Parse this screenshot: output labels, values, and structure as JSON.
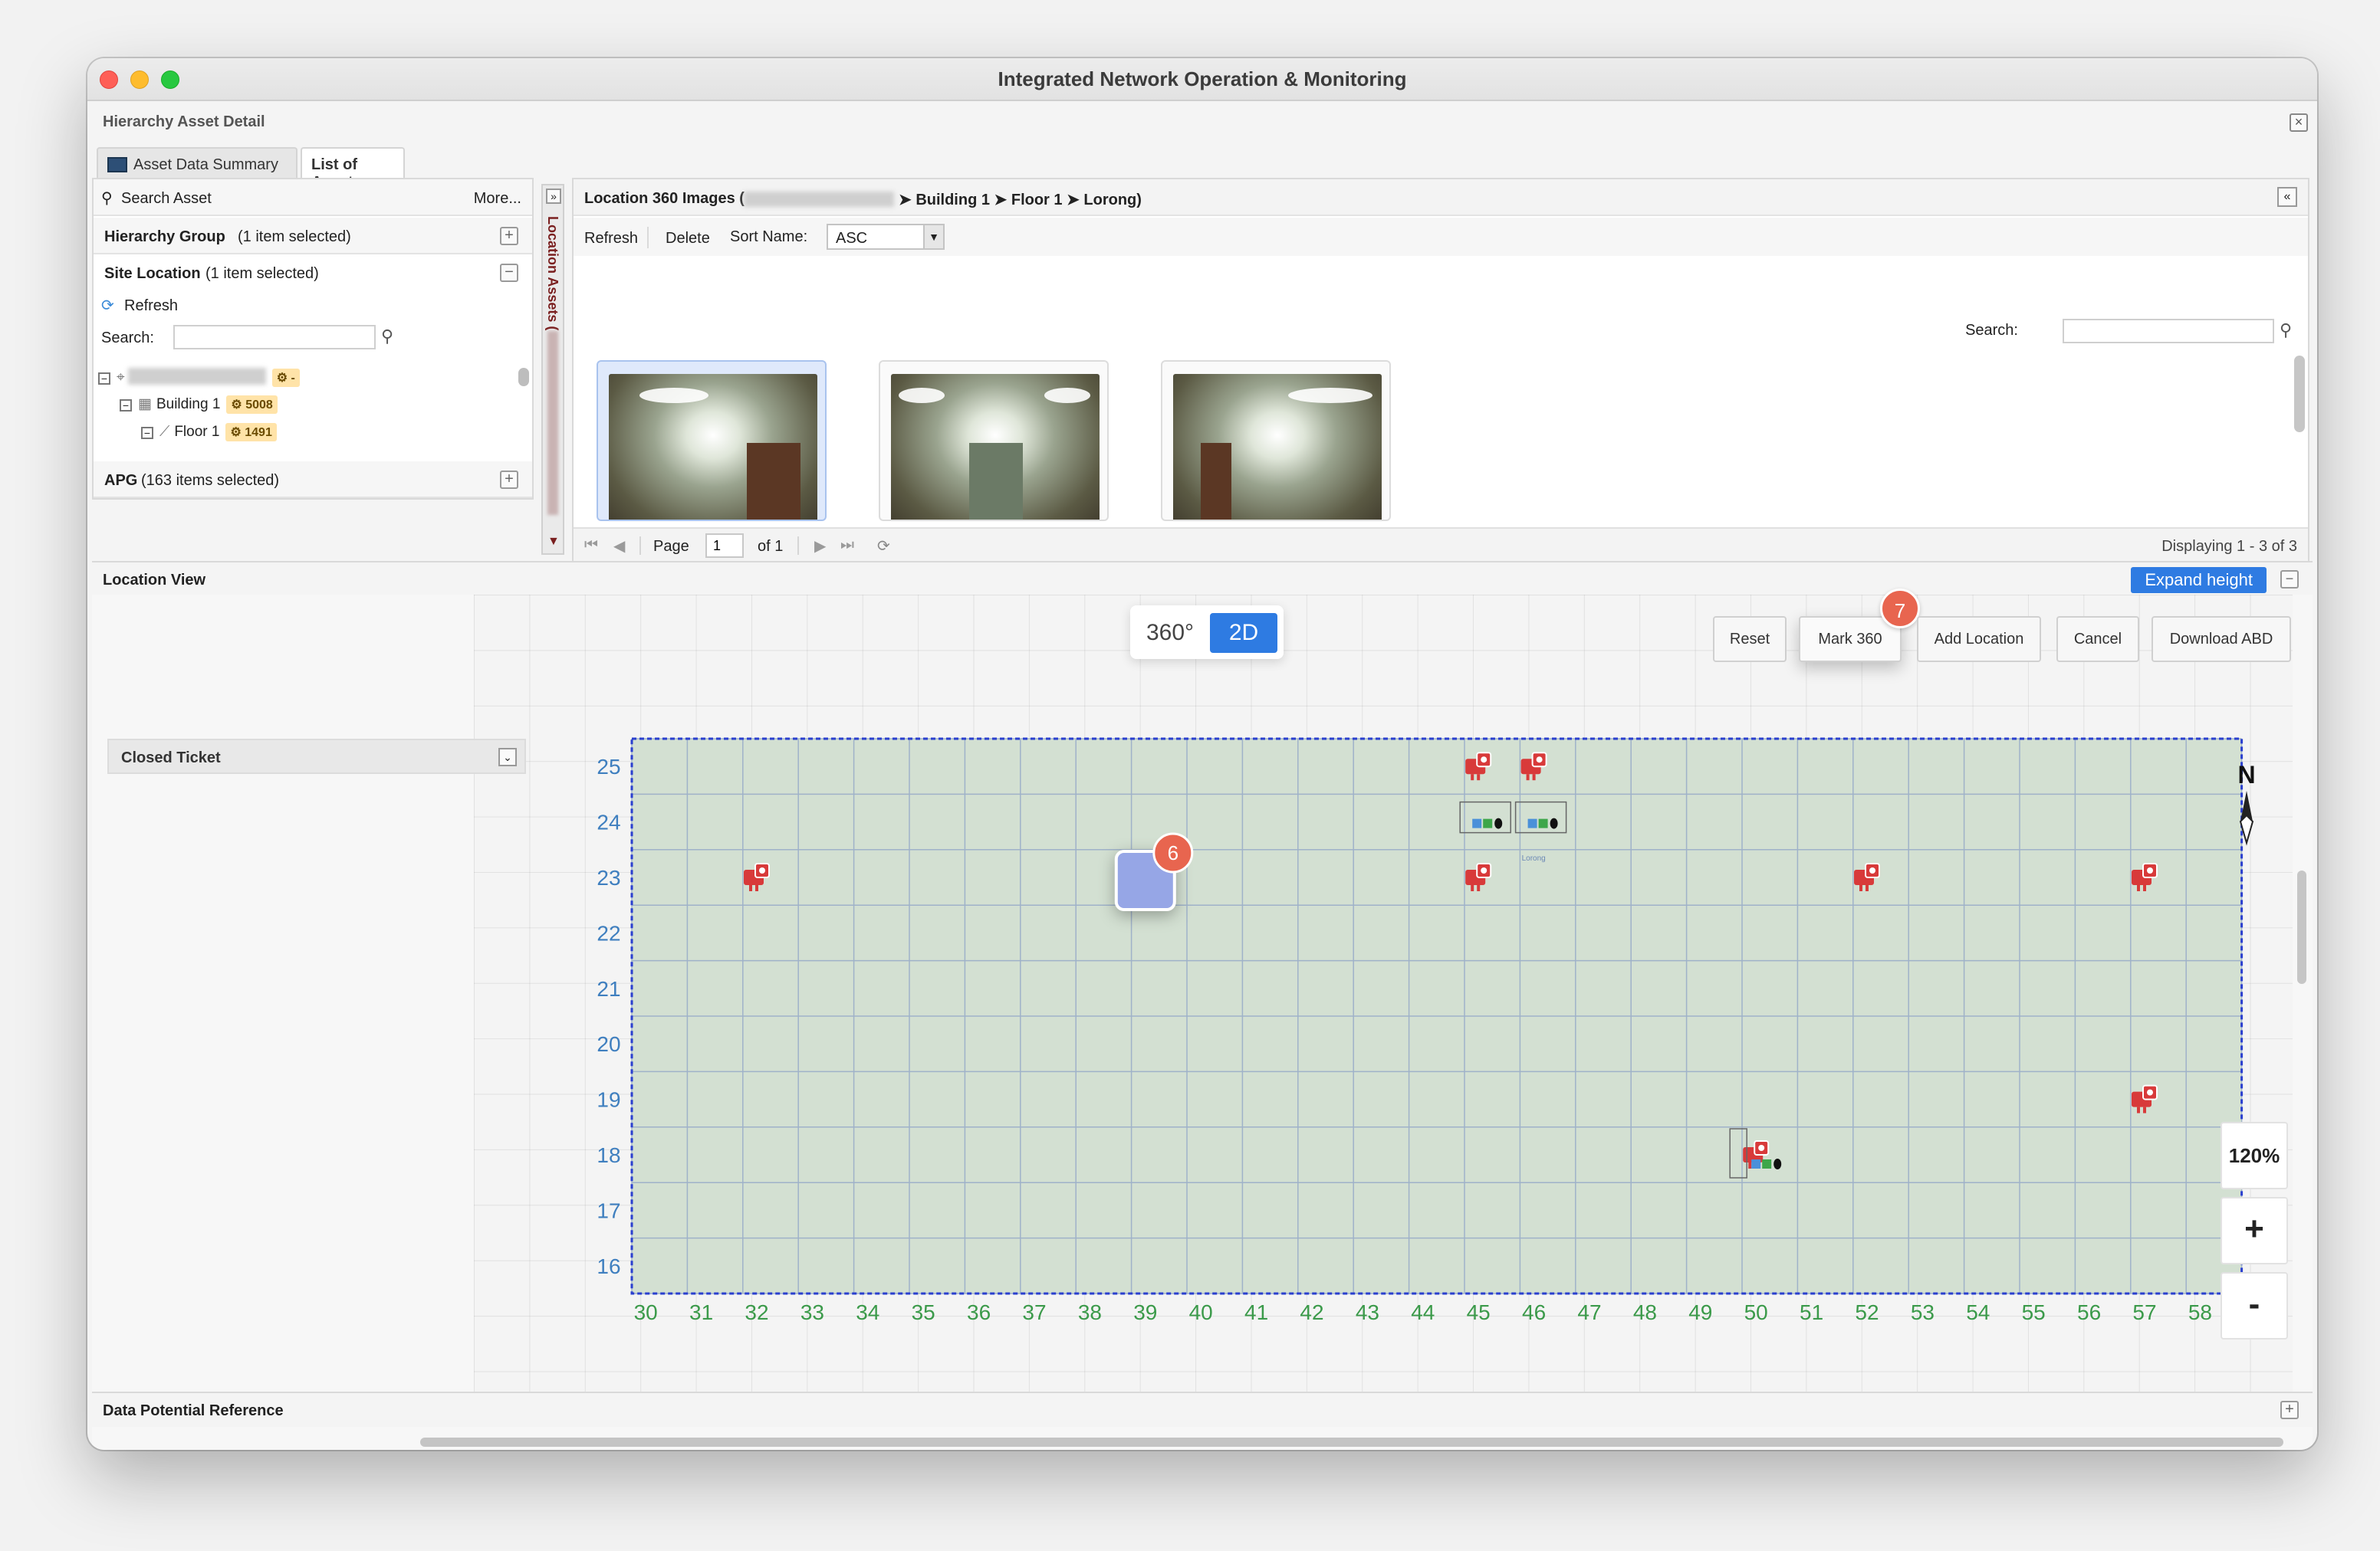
{
  "window": {
    "title": "Integrated Network Operation & Monitoring"
  },
  "panel": {
    "title": "Hierarchy Asset Detail",
    "close_icon": "close-icon"
  },
  "tabs": [
    {
      "label": "Asset Data Summary",
      "icon": "monitor-icon",
      "active": false
    },
    {
      "label": "List of Asset",
      "active": true
    }
  ],
  "left": {
    "search_asset_label": "Search Asset",
    "more_label": "More...",
    "hierarchy_group": {
      "label": "Hierarchy Group",
      "count": "(1 item selected)"
    },
    "site_location": {
      "label": "Site Location",
      "count": "(1 item selected)"
    },
    "refresh_label": "Refresh",
    "search_label": "Search:",
    "search_value": "",
    "tree": [
      {
        "label": "",
        "badge": "-",
        "level": 0
      },
      {
        "label": "Building 1",
        "badge": "5008",
        "level": 1
      },
      {
        "label": "Floor 1",
        "badge": "1491",
        "level": 2
      }
    ],
    "apg": {
      "label": "APG",
      "count": "(163 items selected)"
    }
  },
  "sidebar_vertical": {
    "label": "Location Assets ("
  },
  "right": {
    "header": {
      "prefix": "Location 360 Images (",
      "path": "➤ Building 1 ➤ Floor 1 ➤ Lorong)"
    },
    "toolbar": {
      "refresh": "Refresh",
      "delete": "Delete",
      "sort_label": "Sort Name:",
      "sort_value": "ASC"
    },
    "search_label": "Search:",
    "search_value": "",
    "pager": {
      "page_label": "Page",
      "page_value": "1",
      "of_label": "of 1",
      "display": "Displaying 1 - 3 of 3"
    }
  },
  "location_view": {
    "title": "Location View",
    "expand_label": "Expand height",
    "closed_ticket": "Closed Ticket",
    "seg_360": "360°",
    "seg_2d": "2D",
    "buttons": {
      "reset": "Reset",
      "mark360": "Mark 360",
      "add_location": "Add Location",
      "cancel": "Cancel",
      "download": "Download ABD"
    },
    "markers": {
      "mark": "7",
      "tile": "6"
    },
    "compass_label": "N",
    "zoom_level": "120%",
    "zoom_in": "+",
    "zoom_out": "-",
    "tiny_label": "Lorong",
    "rows": [
      "25",
      "24",
      "23",
      "22",
      "21",
      "20",
      "19",
      "18",
      "17",
      "16"
    ],
    "cols": [
      "30",
      "31",
      "32",
      "33",
      "34",
      "35",
      "36",
      "37",
      "38",
      "39",
      "40",
      "41",
      "42",
      "43",
      "44",
      "45",
      "46",
      "47",
      "48",
      "49",
      "50",
      "51",
      "52",
      "53",
      "54",
      "55",
      "56",
      "57",
      "58"
    ]
  },
  "footer": {
    "data_ref": "Data Potential Reference"
  },
  "colors": {
    "accent": "#2e7be2",
    "grid_fill": "#d3e0d2",
    "marker": "#e8654f",
    "device_red": "#d83a3a",
    "ylabels": "#3f7fbf",
    "xlabels": "#3b9a4a"
  }
}
